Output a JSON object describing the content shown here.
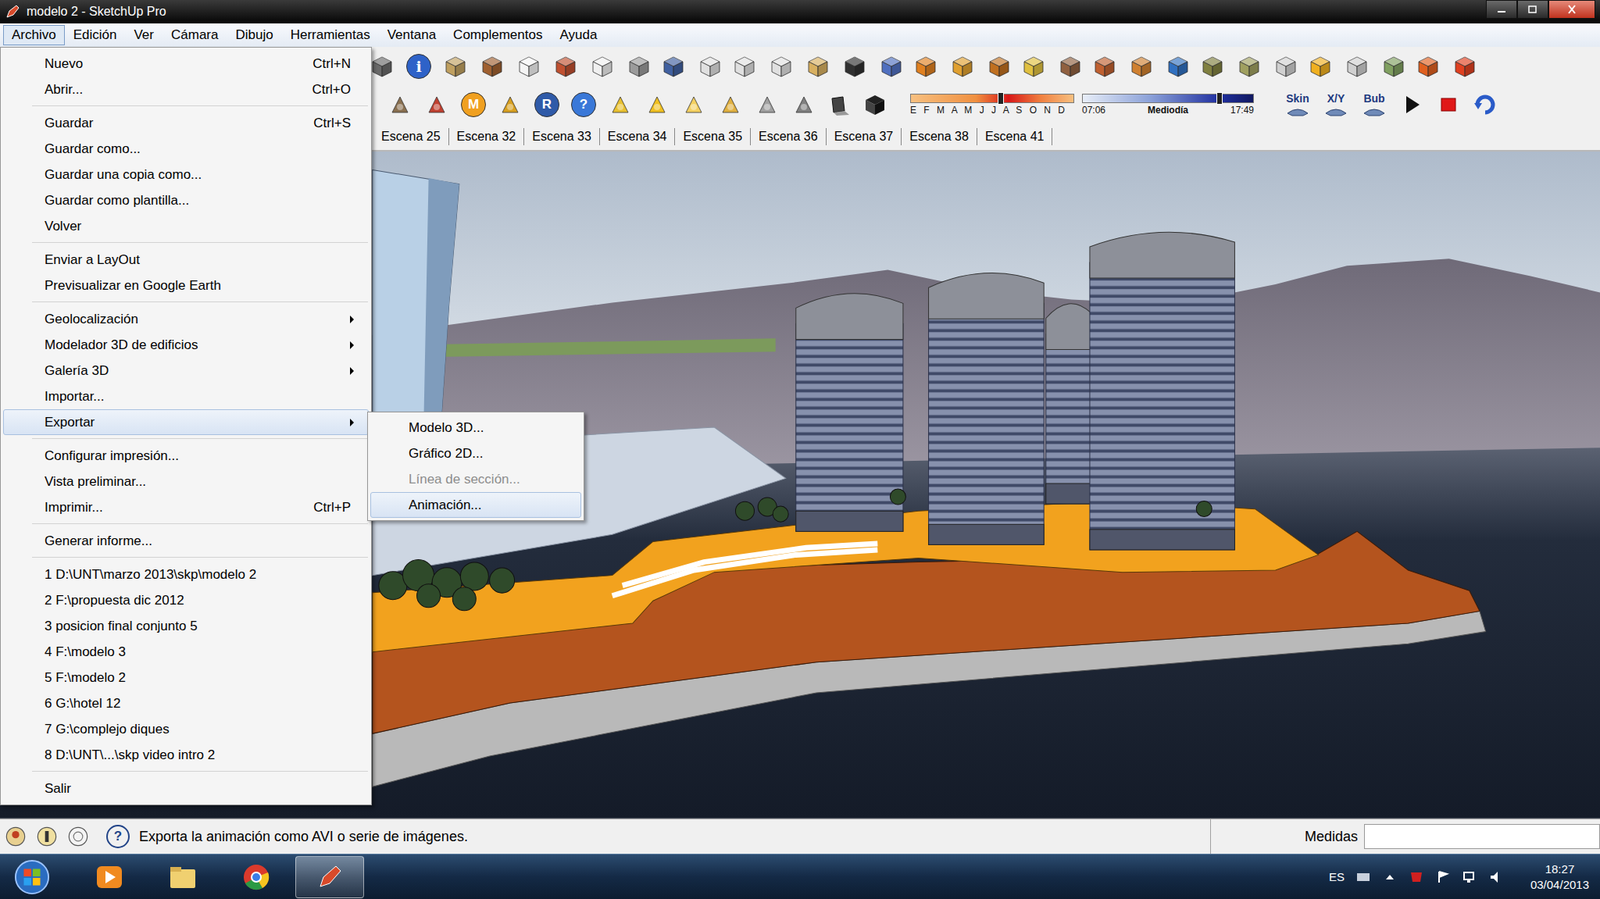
{
  "window": {
    "title": "modelo 2 - SketchUp Pro"
  },
  "menubar": [
    {
      "label": "Archivo",
      "selected": true
    },
    {
      "label": "Edición",
      "selected": false
    },
    {
      "label": "Ver",
      "selected": false
    },
    {
      "label": "Cámara",
      "selected": false
    },
    {
      "label": "Dibujo",
      "selected": false
    },
    {
      "label": "Herramientas",
      "selected": false
    },
    {
      "label": "Ventana",
      "selected": false
    },
    {
      "label": "Complementos",
      "selected": false
    },
    {
      "label": "Ayuda",
      "selected": false
    }
  ],
  "toolbar": {
    "info_icon": "i",
    "letter_icons": [
      {
        "label": "M",
        "color": "#f0a020"
      },
      {
        "label": "R",
        "color": "#2f5aa8"
      },
      {
        "label": "?",
        "color": "#3a78d8"
      }
    ],
    "plugin_buttons": [
      "Skin",
      "X/Y",
      "Bub"
    ]
  },
  "shadow_settings": {
    "months": "E F M A M J J A S O N D",
    "date_level": 0.55,
    "time_start": "07:06",
    "time_mid": "Mediodía",
    "time_end": "17:49",
    "time_level": 0.8
  },
  "scene_tabs": [
    {
      "label": "Escena 25",
      "selected": false
    },
    {
      "label": "Escena 32",
      "selected": false
    },
    {
      "label": "Escena 33",
      "selected": false
    },
    {
      "label": "Escena 34",
      "selected": false
    },
    {
      "label": "Escena 35",
      "selected": false
    },
    {
      "label": "Escena 36",
      "selected": false
    },
    {
      "label": "Escena 37",
      "selected": false
    },
    {
      "label": "Escena 38",
      "selected": false
    },
    {
      "label": "Escena 41",
      "selected": false
    }
  ],
  "file_menu": {
    "groups": [
      [
        {
          "label": "Nuevo",
          "shortcut": "Ctrl+N",
          "submenu": false,
          "selected": false
        },
        {
          "label": "Abrir...",
          "shortcut": "Ctrl+O",
          "submenu": false,
          "selected": false
        }
      ],
      [
        {
          "label": "Guardar",
          "shortcut": "Ctrl+S",
          "submenu": false,
          "selected": false
        },
        {
          "label": "Guardar como...",
          "shortcut": "",
          "submenu": false,
          "selected": false
        },
        {
          "label": "Guardar una copia como...",
          "shortcut": "",
          "submenu": false,
          "selected": false
        },
        {
          "label": "Guardar como plantilla...",
          "shortcut": "",
          "submenu": false,
          "selected": false
        },
        {
          "label": "Volver",
          "shortcut": "",
          "submenu": false,
          "selected": false
        }
      ],
      [
        {
          "label": "Enviar a LayOut",
          "shortcut": "",
          "submenu": false,
          "selected": false
        },
        {
          "label": "Previsualizar en Google Earth",
          "shortcut": "",
          "submenu": false,
          "selected": false
        }
      ],
      [
        {
          "label": "Geolocalización",
          "shortcut": "",
          "submenu": true,
          "selected": false
        },
        {
          "label": "Modelador 3D de edificios",
          "shortcut": "",
          "submenu": true,
          "selected": false
        },
        {
          "label": "Galería 3D",
          "shortcut": "",
          "submenu": true,
          "selected": false
        },
        {
          "label": "Importar...",
          "shortcut": "",
          "submenu": false,
          "selected": false
        },
        {
          "label": "Exportar",
          "shortcut": "",
          "submenu": true,
          "selected": true
        }
      ],
      [
        {
          "label": "Configurar impresión...",
          "shortcut": "",
          "submenu": false,
          "selected": false
        },
        {
          "label": "Vista preliminar...",
          "shortcut": "",
          "submenu": false,
          "selected": false
        },
        {
          "label": "Imprimir...",
          "shortcut": "Ctrl+P",
          "submenu": false,
          "selected": false
        }
      ],
      [
        {
          "label": "Generar informe...",
          "shortcut": "",
          "submenu": false,
          "selected": false
        }
      ],
      [
        {
          "label": "1 D:\\UNT\\marzo 2013\\skp\\modelo 2",
          "shortcut": "",
          "submenu": false,
          "selected": false
        },
        {
          "label": "2 F:\\propuesta dic 2012",
          "shortcut": "",
          "submenu": false,
          "selected": false
        },
        {
          "label": "3 posicion final conjunto 5",
          "shortcut": "",
          "submenu": false,
          "selected": false
        },
        {
          "label": "4 F:\\modelo 3",
          "shortcut": "",
          "submenu": false,
          "selected": false
        },
        {
          "label": "5 F:\\modelo 2",
          "shortcut": "",
          "submenu": false,
          "selected": false
        },
        {
          "label": "6 G:\\hotel 12",
          "shortcut": "",
          "submenu": false,
          "selected": false
        },
        {
          "label": "7 G:\\complejo diques",
          "shortcut": "",
          "submenu": false,
          "selected": false
        },
        {
          "label": "8 D:\\UNT\\...\\skp video intro 2",
          "shortcut": "",
          "submenu": false,
          "selected": false
        }
      ],
      [
        {
          "label": "Salir",
          "shortcut": "",
          "submenu": false,
          "selected": false
        }
      ]
    ]
  },
  "export_submenu": [
    {
      "label": "Modelo 3D...",
      "disabled": false,
      "selected": false
    },
    {
      "label": "Gráfico 2D...",
      "disabled": false,
      "selected": false
    },
    {
      "label": "Línea de sección...",
      "disabled": true,
      "selected": false
    },
    {
      "label": "Animación...",
      "disabled": false,
      "selected": true
    }
  ],
  "status_bar": {
    "help_icon": "?",
    "hint": "Exporta la animación como AVI o serie de imágenes.",
    "measurements_label": "Medidas"
  },
  "taskbar": {
    "language": "ES",
    "time": "18:27",
    "date": "03/04/2013"
  }
}
